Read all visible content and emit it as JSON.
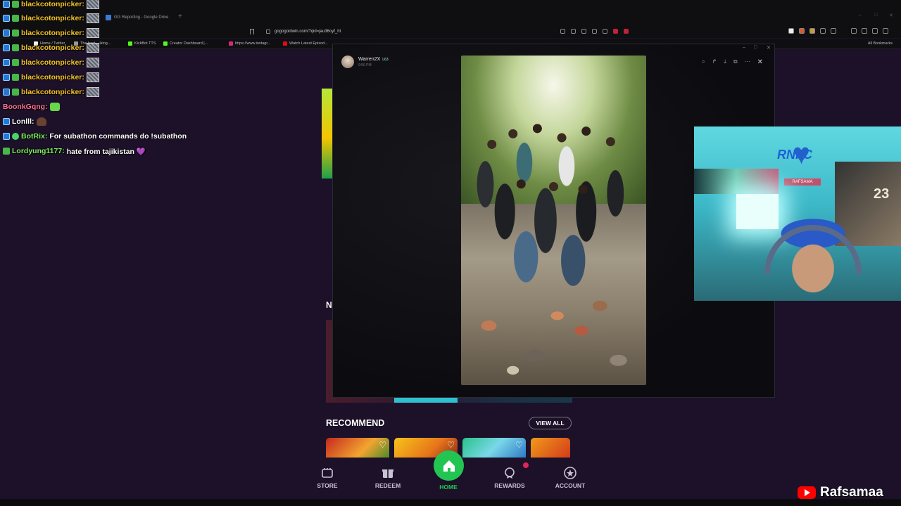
{
  "browser": {
    "tab_title": "GG Reporting - Google Drive",
    "url": "gogogoldwin.com/?qid=jau36oyf_ht",
    "bookmarks": [
      "Home / Twitter",
      "The best ...iking...",
      "KickBot TTS",
      "Creator Dashboard |...",
      "https://www.instagr...",
      "Watch Latest Episod..."
    ],
    "all_bookmarks": "All Bookmarks"
  },
  "chat": {
    "lines": [
      {
        "user": "blackcotonpicker:",
        "msg": ""
      },
      {
        "user": "blackcotonpicker:",
        "msg": ""
      },
      {
        "user": "blackcotonpicker:",
        "msg": ""
      },
      {
        "user": "blackcotonpicker:",
        "msg": ""
      },
      {
        "user": "blackcotonpicker:",
        "msg": ""
      },
      {
        "user": "blackcotonpicker:",
        "msg": ""
      },
      {
        "user": "blackcotonpicker:",
        "msg": ""
      },
      {
        "user": "BoonkGqng:",
        "msg": ""
      },
      {
        "user": "Lonlll:",
        "msg": ""
      },
      {
        "user": "BotRix:",
        "msg": "For subathon commands do !subathon"
      },
      {
        "user": "Lordyung1177:",
        "msg": "hate from tajikistan 💜"
      }
    ]
  },
  "viewer": {
    "poster_name": "Warren2X",
    "poster_badge": "L63",
    "poster_time": "9:56 PM"
  },
  "app": {
    "section_letter": "N",
    "recommend_title": "RECOMMEND",
    "view_all": "VIEW ALL",
    "nav": {
      "store": "STORE",
      "redeem": "REDEEM",
      "home": "HOME",
      "rewards": "REWARDS",
      "account": "ACCOUNT"
    }
  },
  "webcam": {
    "sign": "RNFC",
    "banner": "RAFSAMA",
    "jersey": "23"
  },
  "watermark": {
    "channel": "Rafsamaa"
  },
  "colors": {
    "accent_green": "#23c552",
    "bg_purple": "#1c1129",
    "chat_user": "#f3c32b"
  }
}
